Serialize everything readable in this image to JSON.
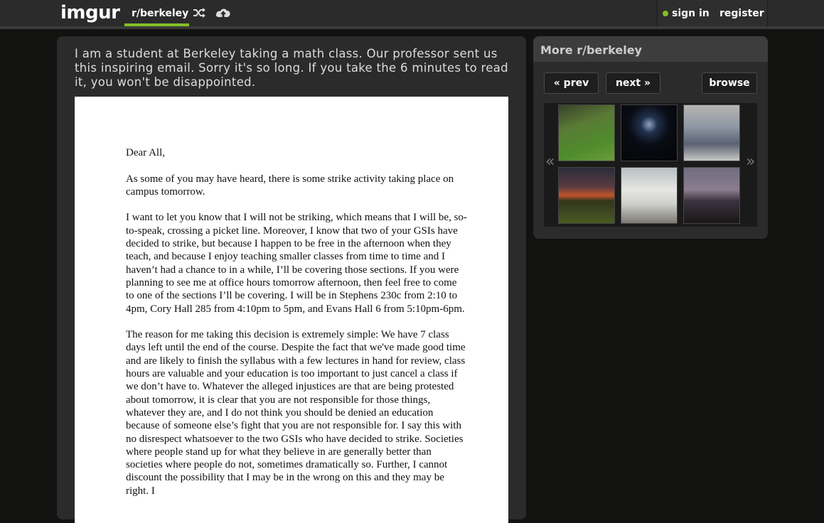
{
  "header": {
    "logo": "imgur",
    "subreddit": "r/berkeley",
    "shuffle_icon": "shuffle-icon",
    "upload_icon": "upload-icon",
    "signin": "sign in",
    "register": "register",
    "accent_color": "#85bf25"
  },
  "post": {
    "title": "I am a student at Berkeley taking a math class. Our professor sent us this inspiring email. Sorry it's so long. If you take the 6 minutes to read it, you won't be disappointed.",
    "letter": [
      "Dear All,",
      "As some of you may have heard, there is some strike activity taking place on campus tomorrow.",
      "I want to let you know that I will not be striking, which means that I will be, so-to-speak, crossing a picket line. Moreover, I know that two of your GSIs have decided to strike, but because I happen to be free in the afternoon when they teach, and because I enjoy teaching smaller classes from time to time and I haven’t had a chance to in a while, I’ll be covering those sections. If you were planning to see me at office hours tomorrow afternoon, then feel free to come to one of the sections I’ll be covering. I will be in Stephens 230c from 2:10 to 4pm, Cory Hall 285 from 4:10pm to 5pm, and Evans Hall 6 from 5:10pm-6pm.",
      "The reason for me taking this decision is extremely simple: We have 7 class days left until the end of the course. Despite the fact that we've made good time and are likely to finish the syllabus with a few lectures in hand for review, class hours are valuable and your education is too important to just cancel a class if we don’t have to. Whatever the alleged injustices are that are being protested about tomorrow, it is clear that you are not responsible for those things, whatever they are, and I do not think you should be denied an education because of someone else’s fight that you are not responsible for. I say this with no disrespect whatsoever to the two GSIs who have decided to strike. Societies where people stand up for what they believe in are generally better than societies where people do not, sometimes dramatically so. Further, I cannot discount the possibility that I may be in the wrong on this and they may be right. I"
    ]
  },
  "sidebar": {
    "title": "More r/berkeley",
    "prev": "« prev",
    "next": "next »",
    "browse": "browse",
    "left_arrow": "«",
    "right_arrow": "»"
  }
}
